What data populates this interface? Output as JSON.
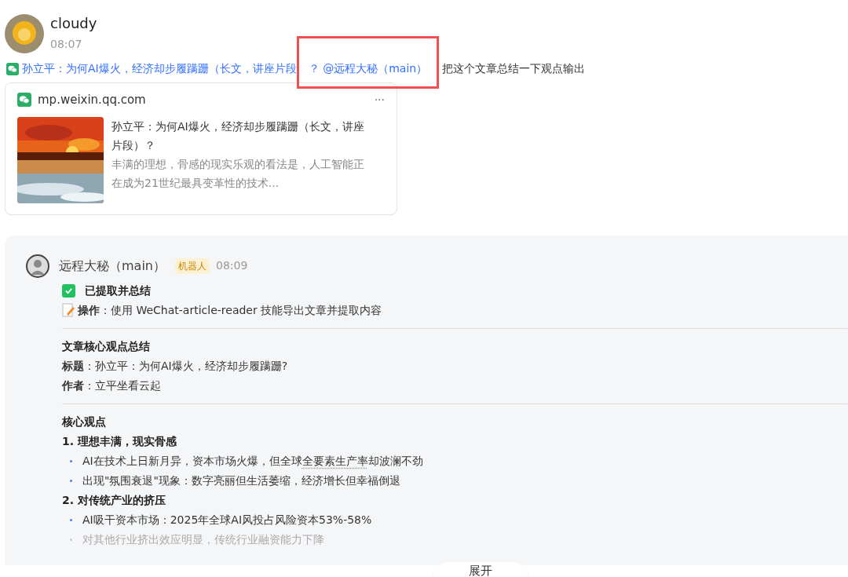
{
  "user_message": {
    "sender": "cloudy",
    "time": "08:07",
    "link_text": "孙立平：为何AI爆火，经济却步履蹒跚（长文，讲座片段",
    "highlighted_text": "？ @远程大秘（main）",
    "text": "把这个文章总结一下观点输出",
    "card": {
      "domain": "mp.weixin.qq.com",
      "more": "···",
      "title": "孙立平：为何AI爆火，经济却步履蹒跚（长文，讲座片段）？",
      "summary": "丰满的理想，骨感的现实乐观的看法是，人工智能正在成为21世纪最具变革性的技术..."
    }
  },
  "bot_message": {
    "sender": "远程大秘（main）",
    "badge": "机器人",
    "time": "08:09",
    "status": {
      "checked": true,
      "text": "已提取并总结"
    },
    "operation": {
      "label": "操作",
      "text": "：使用 WeChat-article-reader 技能导出文章并提取内容"
    },
    "summary_title": "文章核心观点总结",
    "fields": [
      {
        "label": "标题",
        "text": "：孙立平：为何AI爆火，经济却步履蹒跚?"
      },
      {
        "label": "作者",
        "text": "：立平坐看云起"
      }
    ],
    "core_title": "核心观点",
    "sections": [
      {
        "heading": "1. 理想丰满，现实骨感",
        "items": [
          {
            "faded": false,
            "text": "AI在技术上日新月异，资本市场火爆，但全球",
            "term": "全要素生产率",
            "text_after": "却波澜不劲"
          },
          {
            "faded": false,
            "text": "出现\"氛围衰退\"现象：数字亮丽但生活萎缩，经济增长但幸福倒退"
          }
        ]
      },
      {
        "heading": "2. 对传统产业的挤压",
        "items": [
          {
            "faded": false,
            "text": "AI吸干资本市场：2025年全球AI风投占风险资本53%-58%"
          },
          {
            "faded": true,
            "text": "对其他行业挤出效应明显，传统行业融资能力下降"
          }
        ]
      }
    ],
    "expand_button": "展开"
  }
}
